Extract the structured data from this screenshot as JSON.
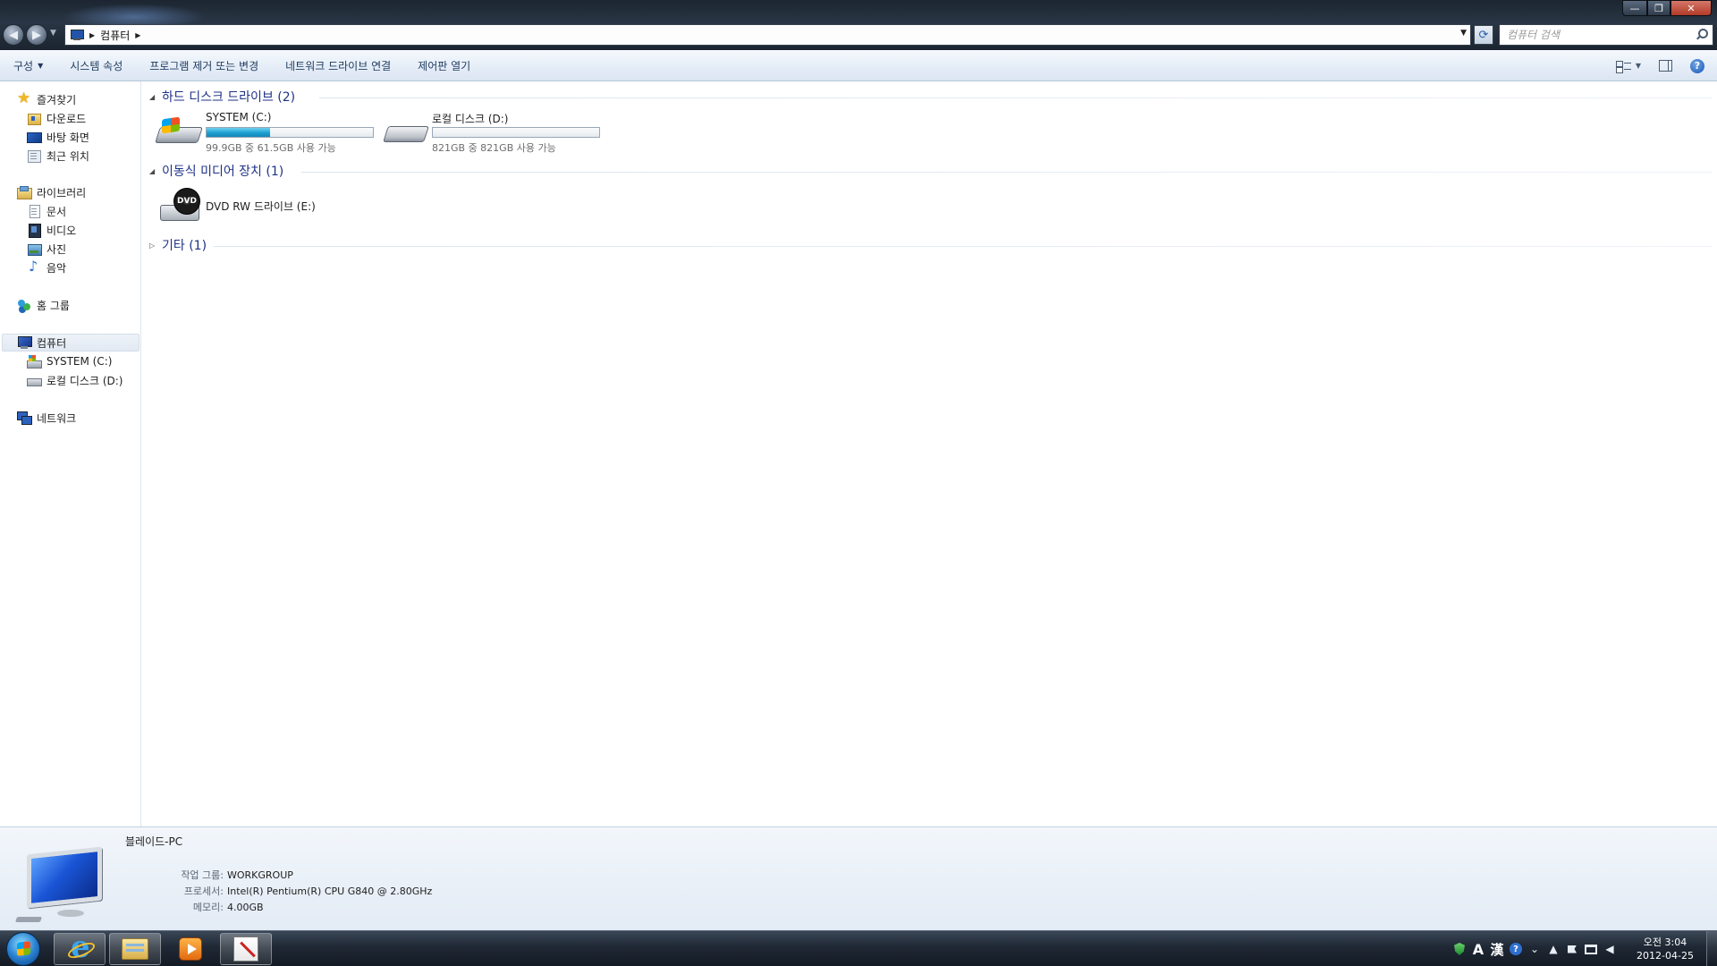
{
  "address": {
    "crumb": "컴퓨터",
    "search_placeholder": "컴퓨터 검색"
  },
  "window": {
    "minimize_glyph": "—",
    "maximize_glyph": "❐",
    "close_glyph": "✕"
  },
  "commands": {
    "organize": "구성",
    "system_properties": "시스템 속성",
    "uninstall": "프로그램 제거 또는 변경",
    "map_drive": "네트워크 드라이브 연결",
    "control_panel": "제어판 열기"
  },
  "nav": {
    "favorites": "즐겨찾기",
    "downloads": "다운로드",
    "desktop": "바탕 화면",
    "recent": "최근 위치",
    "libraries": "라이브러리",
    "documents": "문서",
    "videos": "비디오",
    "pictures": "사진",
    "music": "음악",
    "homegroup": "홈 그룹",
    "computer": "컴퓨터",
    "system_c": "SYSTEM (C:)",
    "local_d": "로컬 디스크 (D:)",
    "network": "네트워크"
  },
  "groups": {
    "hdd": "하드 디스크 드라이브 (2)",
    "removable": "이동식 미디어 장치 (1)",
    "other": "기타 (1)"
  },
  "drives": [
    {
      "name": "SYSTEM (C:)",
      "space": "99.9GB 중 61.5GB 사용 가능",
      "used_fraction": 0.384
    },
    {
      "name": "로컬 디스크 (D:)",
      "space": "821GB 중 821GB 사용 가능",
      "used_fraction": 0.0
    }
  ],
  "dvd": {
    "name": "DVD RW 드라이브 (E:)"
  },
  "details": {
    "pc_name": "블레이드-PC",
    "workgroup_label": "작업 그룹:",
    "workgroup": "WORKGROUP",
    "processor_label": "프로세서:",
    "processor": "Intel(R) Pentium(R) CPU G840 @ 2.80GHz",
    "memory_label": "메모리:",
    "memory": "4.00GB"
  },
  "tray": {
    "ime_mode": "A",
    "ime_hanja": "漢",
    "time": "오전 3:04",
    "date": "2012-04-25"
  },
  "colors": {
    "accent_blue": "#1e3287",
    "bar_fill": "#1b9fd0"
  }
}
